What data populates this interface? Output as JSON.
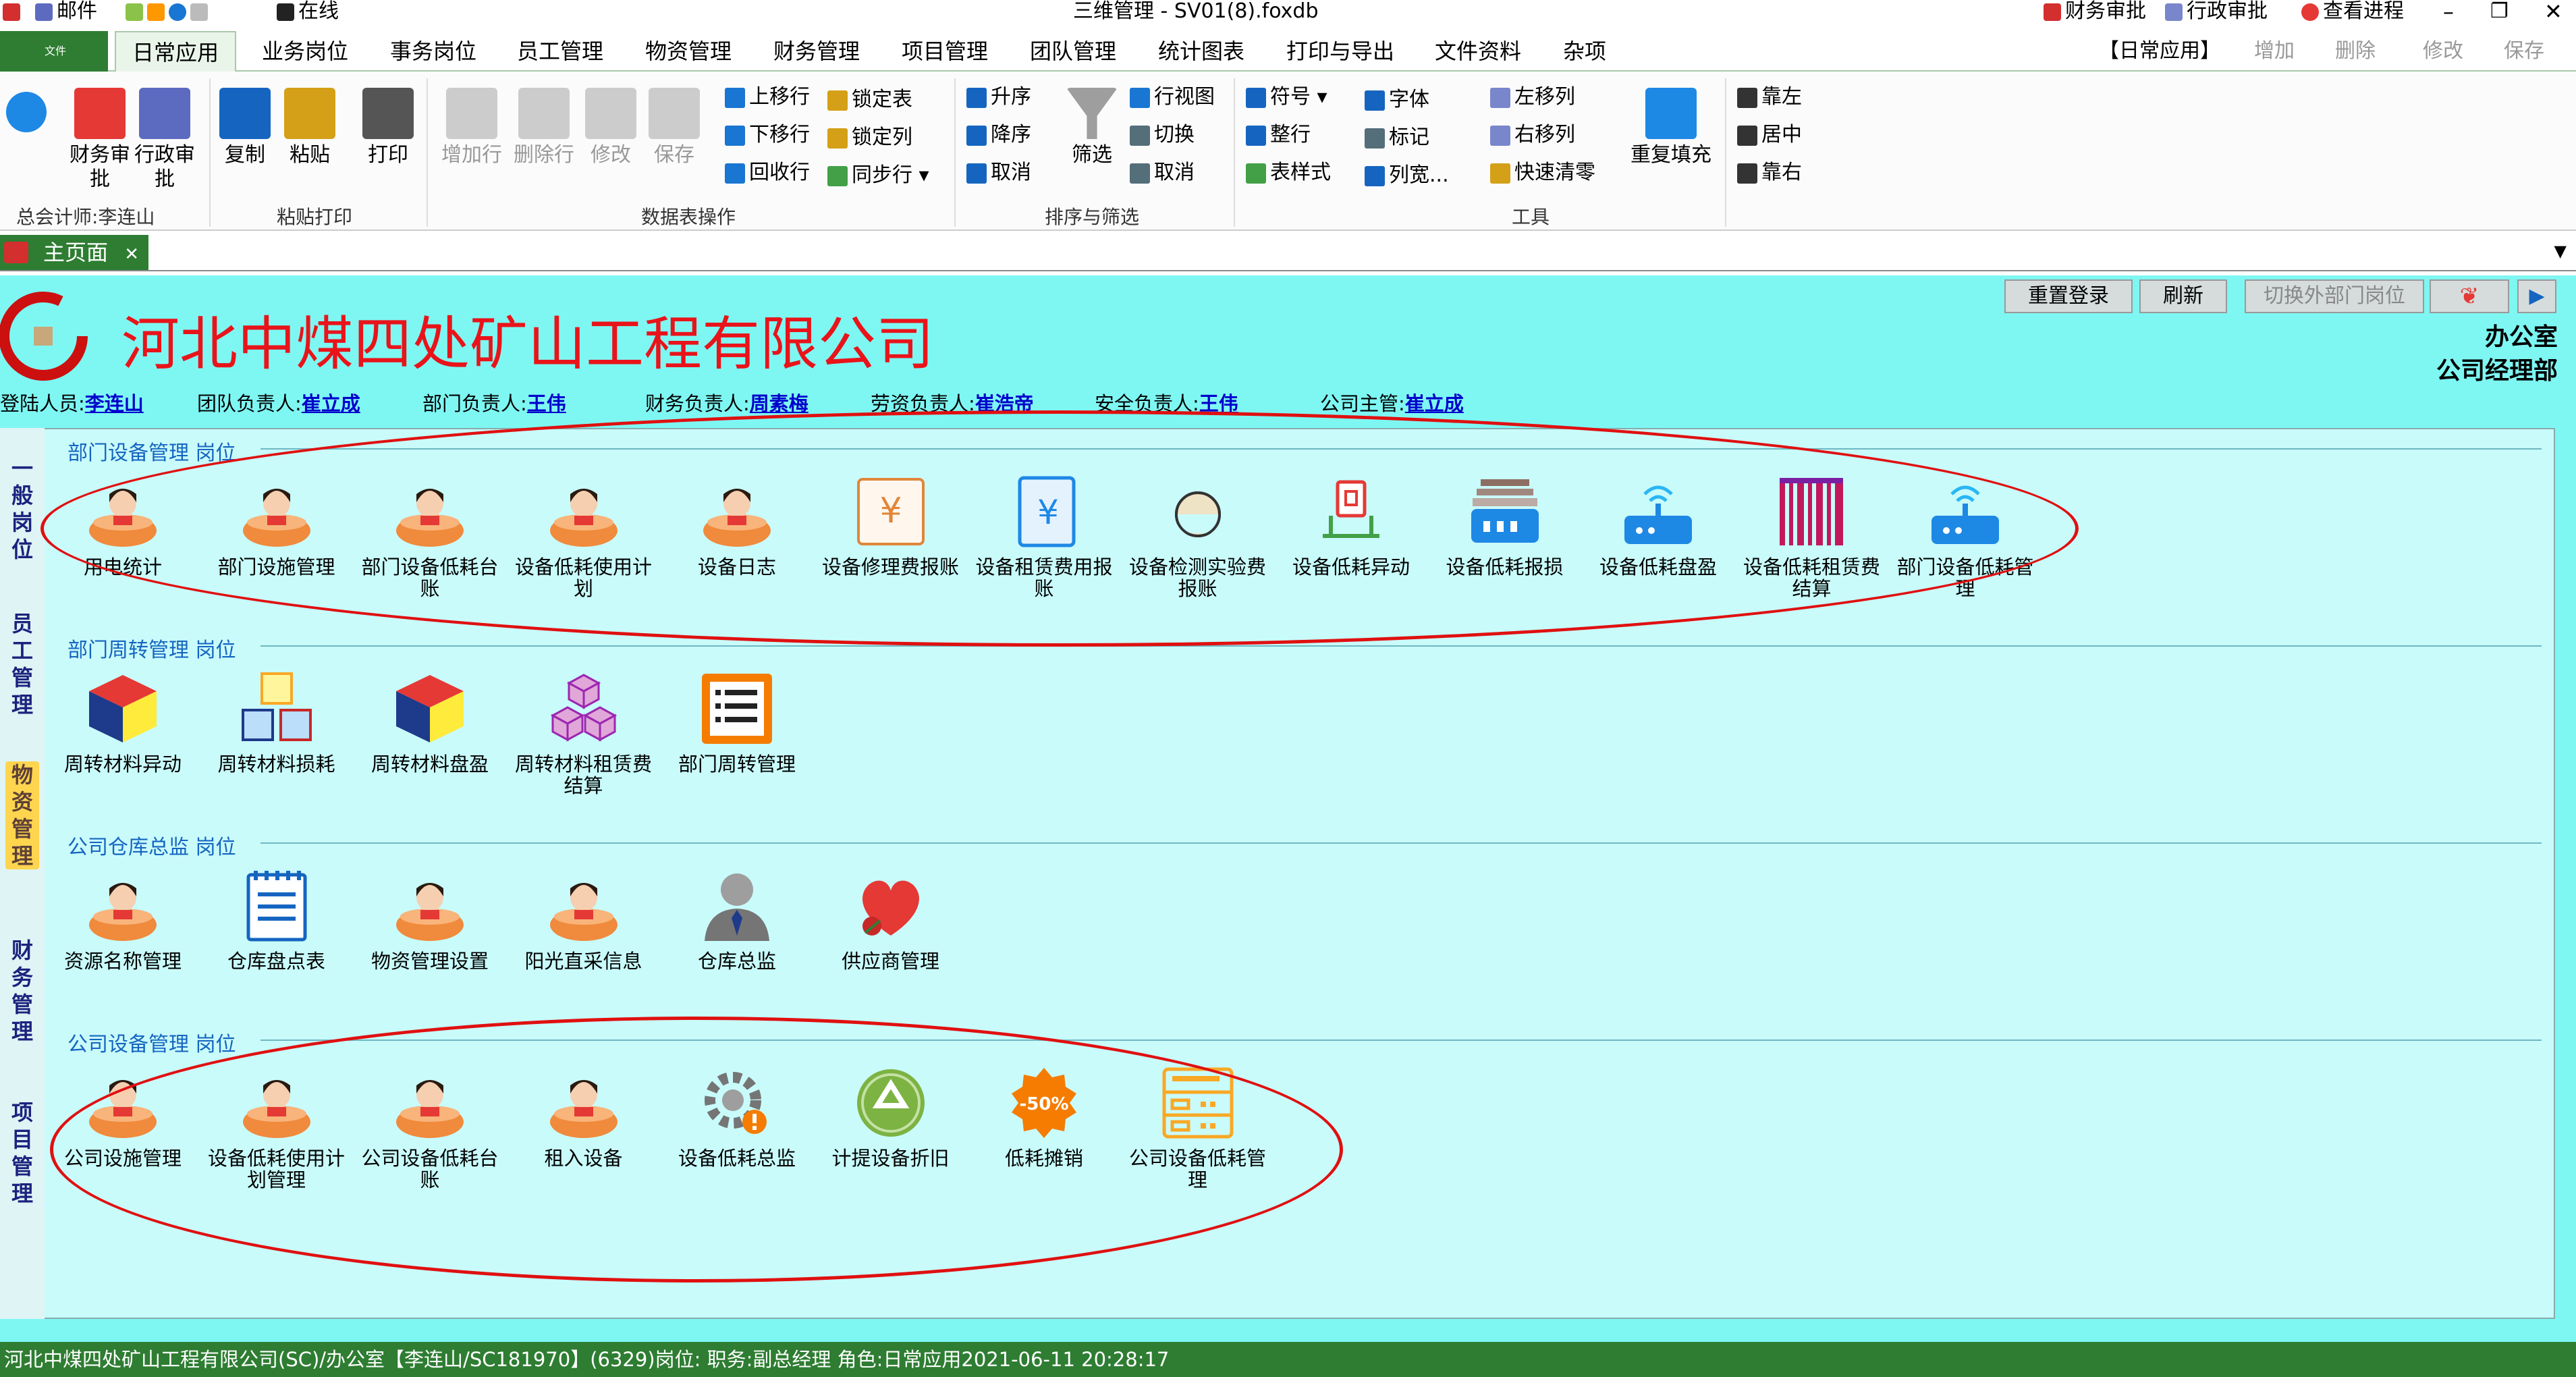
{
  "title_bar": {
    "mail": "邮件",
    "online": "在线",
    "window_title": "三维管理 - SV01(8).foxdb",
    "fin_approval": "财务审批",
    "admin_approval": "行政审批",
    "view_process": "查看进程"
  },
  "menu": {
    "file": "文件",
    "tabs": [
      "日常应用",
      "业务岗位",
      "事务岗位",
      "员工管理",
      "物资管理",
      "财务管理",
      "项目管理",
      "团队管理",
      "统计图表",
      "打印与导出",
      "文件资料",
      "杂项"
    ],
    "right_group": "【日常应用】",
    "right_actions": [
      "增加",
      "删除",
      "修改",
      "保存"
    ]
  },
  "ribbon": {
    "big": [
      "财务审批",
      "行政审批",
      "复制",
      "粘贴",
      "打印",
      "增加行",
      "删除行",
      "修改",
      "保存",
      "筛选",
      "重复填充"
    ],
    "col1": [
      "上移行",
      "下移行",
      "回收行"
    ],
    "col2": [
      "锁定表",
      "锁定列",
      "同步行"
    ],
    "sort": [
      "升序",
      "降序",
      "取消"
    ],
    "view": [
      "行视图",
      "切换",
      "取消"
    ],
    "tool1": [
      "符号",
      "整行",
      "表样式"
    ],
    "tool2": [
      "字体",
      "标记",
      "列宽..."
    ],
    "tool3": [
      "左移列",
      "右移列",
      "快速清零"
    ],
    "align": [
      "靠左",
      "居中",
      "靠右"
    ],
    "groups": [
      "总会计师:李连山",
      "粘贴打印",
      "数据表操作",
      "排序与筛选",
      "工具"
    ]
  },
  "doc_tab": "主页面",
  "header": {
    "company": "河北中煤四处矿山工程有限公司",
    "buttons": [
      "重置登录",
      "刷新",
      "切换外部门岗位"
    ],
    "dept1": "办公室",
    "dept2": "公司经理部"
  },
  "resp": {
    "login_label": "登陆人员:",
    "login": "李连山",
    "team_label": "团队负责人:",
    "team": "崔立成",
    "dept_label": "部门负责人:",
    "dept": "王伟",
    "fin_label": "财务负责人:",
    "fin": "周素梅",
    "labor_label": "劳资负责人:",
    "labor": "崔浩帝",
    "safe_label": "安全负责人:",
    "safe": "王伟",
    "boss_label": "公司主管:",
    "boss": "崔立成"
  },
  "sidebar": [
    "一般岗位",
    "员工管理",
    "物资管理",
    "财务管理",
    "项目管理"
  ],
  "sections": [
    {
      "title": "部门设备管理 岗位",
      "items": [
        "用电统计",
        "部门设施管理",
        "部门设备低耗台账",
        "设备低耗使用计划",
        "设备日志",
        "设备修理费报账",
        "设备租赁费用报账",
        "设备检测实验费报账",
        "设备低耗异动",
        "设备低耗报损",
        "设备低耗盘盈",
        "设备低耗租赁费结算",
        "部门设备低耗管理"
      ]
    },
    {
      "title": "部门周转管理 岗位",
      "items": [
        "周转材料异动",
        "周转材料损耗",
        "周转材料盘盈",
        "周转材料租赁费结算",
        "部门周转管理"
      ]
    },
    {
      "title": "公司仓库总监 岗位",
      "items": [
        "资源名称管理",
        "仓库盘点表",
        "物资管理设置",
        "阳光直采信息",
        "仓库总监",
        "供应商管理"
      ]
    },
    {
      "title": "公司设备管理 岗位",
      "items": [
        "公司设施管理",
        "设备低耗使用计划管理",
        "公司设备低耗台账",
        "租入设备",
        "设备低耗总监",
        "计提设备折旧",
        "低耗摊销",
        "公司设备低耗管理"
      ]
    }
  ],
  "status": "河北中煤四处矿山工程有限公司(SC)/办公室【李连山/SC181970】(6329)岗位:  职务:副总经理  角色:日常应用2021-06-11 20:28:17",
  "icons": {
    "sec0": [
      "woman",
      "woman",
      "woman",
      "woman",
      "woman",
      "yen-doc",
      "yen-book",
      "gauge",
      "red-device",
      "router-stack",
      "router",
      "barcode",
      "router"
    ],
    "sec1": [
      "cube",
      "stacked-boxes",
      "cube",
      "cubes",
      "list"
    ],
    "sec2": [
      "woman",
      "notepad",
      "woman",
      "woman",
      "person",
      "heart"
    ],
    "sec3": [
      "woman",
      "woman",
      "woman",
      "woman",
      "gear-warning",
      "recycle",
      "discount",
      "server"
    ]
  },
  "colors": {
    "accent": "#2e7d32",
    "panel": "#7ef7f3",
    "content": "#c9fbfb",
    "company": "#e8141a",
    "link": "#0000cc",
    "highlight": "#e01010"
  }
}
